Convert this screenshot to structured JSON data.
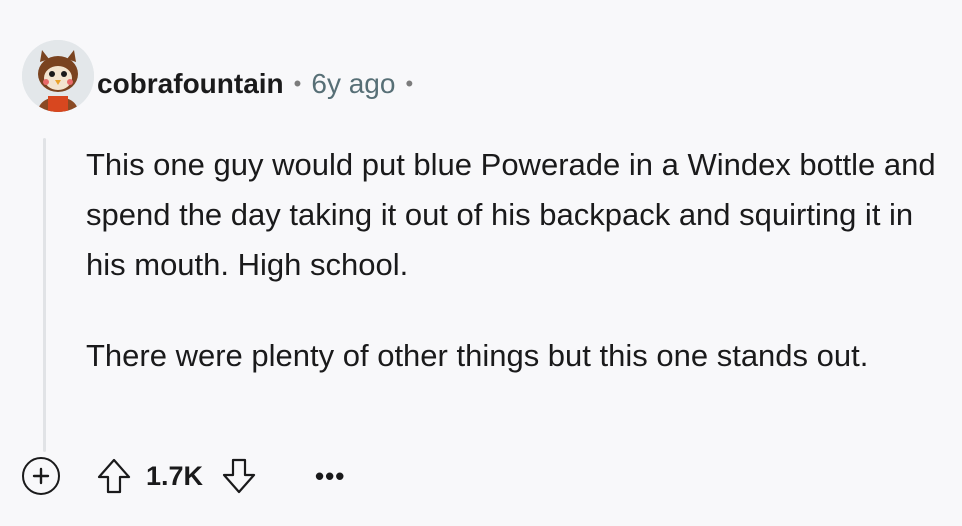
{
  "comment": {
    "username": "cobrafountain",
    "separator": "•",
    "age": "6y ago",
    "trailing_separator": "•",
    "paragraphs": [
      "This one guy would put blue Powerade in a Windex bottle and spend the day taking it out of his backpack and squirting it in his mouth. High school.",
      "There were plenty of other things but this one stands out."
    ]
  },
  "actions": {
    "score": "1.7K",
    "more_label": "•••",
    "icons": {
      "add": "plus-circle-icon",
      "upvote": "arrow-up-icon",
      "downvote": "arrow-down-icon"
    }
  },
  "colors": {
    "background": "#f8f8fa",
    "text": "#1a1a1b",
    "meta": "#576f76",
    "thread_line": "#e1e3e6"
  }
}
